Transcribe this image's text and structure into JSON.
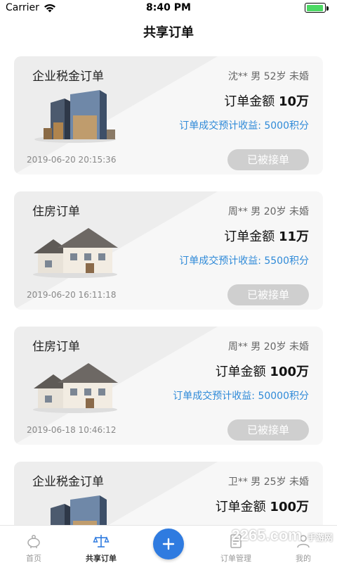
{
  "status_bar": {
    "carrier": "Carrier",
    "time": "8:40 PM",
    "battery_level": 0.95,
    "icons": [
      "wifi-icon",
      "battery-icon"
    ]
  },
  "nav": {
    "title": "共享订单"
  },
  "orders": [
    {
      "type": "企业税金订单",
      "image": "office-buildings",
      "person": "沈** 男 52岁 未婚",
      "amount_label": "订单金额",
      "amount": "10万",
      "income": "订单成交预计收益: 5000积分",
      "date": "2019-06-20 20:15:36",
      "button": "已被接单"
    },
    {
      "type": "住房订单",
      "image": "house",
      "person": "周** 男 20岁 未婚",
      "amount_label": "订单金额",
      "amount": "11万",
      "income": "订单成交预计收益: 5500积分",
      "date": "2019-06-20 16:11:18",
      "button": "已被接单"
    },
    {
      "type": "住房订单",
      "image": "house",
      "person": "周** 男 20岁 未婚",
      "amount_label": "订单金额",
      "amount": "100万",
      "income": "订单成交预计收益: 50000积分",
      "date": "2019-06-18 10:46:12",
      "button": "已被接单"
    },
    {
      "type": "企业税金订单",
      "image": "office-buildings",
      "person": "卫** 男 25岁 未婚",
      "amount_label": "订单金额",
      "amount": "100万",
      "income": "",
      "date": "",
      "button": ""
    }
  ],
  "tabbar": {
    "home": "首页",
    "shared_orders": "共享订单",
    "add_icon": "plus-icon",
    "order_manage": "订单管理",
    "mine": "我的",
    "active_color": "#2f7be0"
  },
  "watermark": {
    "text": "2265.com",
    "sub": "手游网"
  }
}
